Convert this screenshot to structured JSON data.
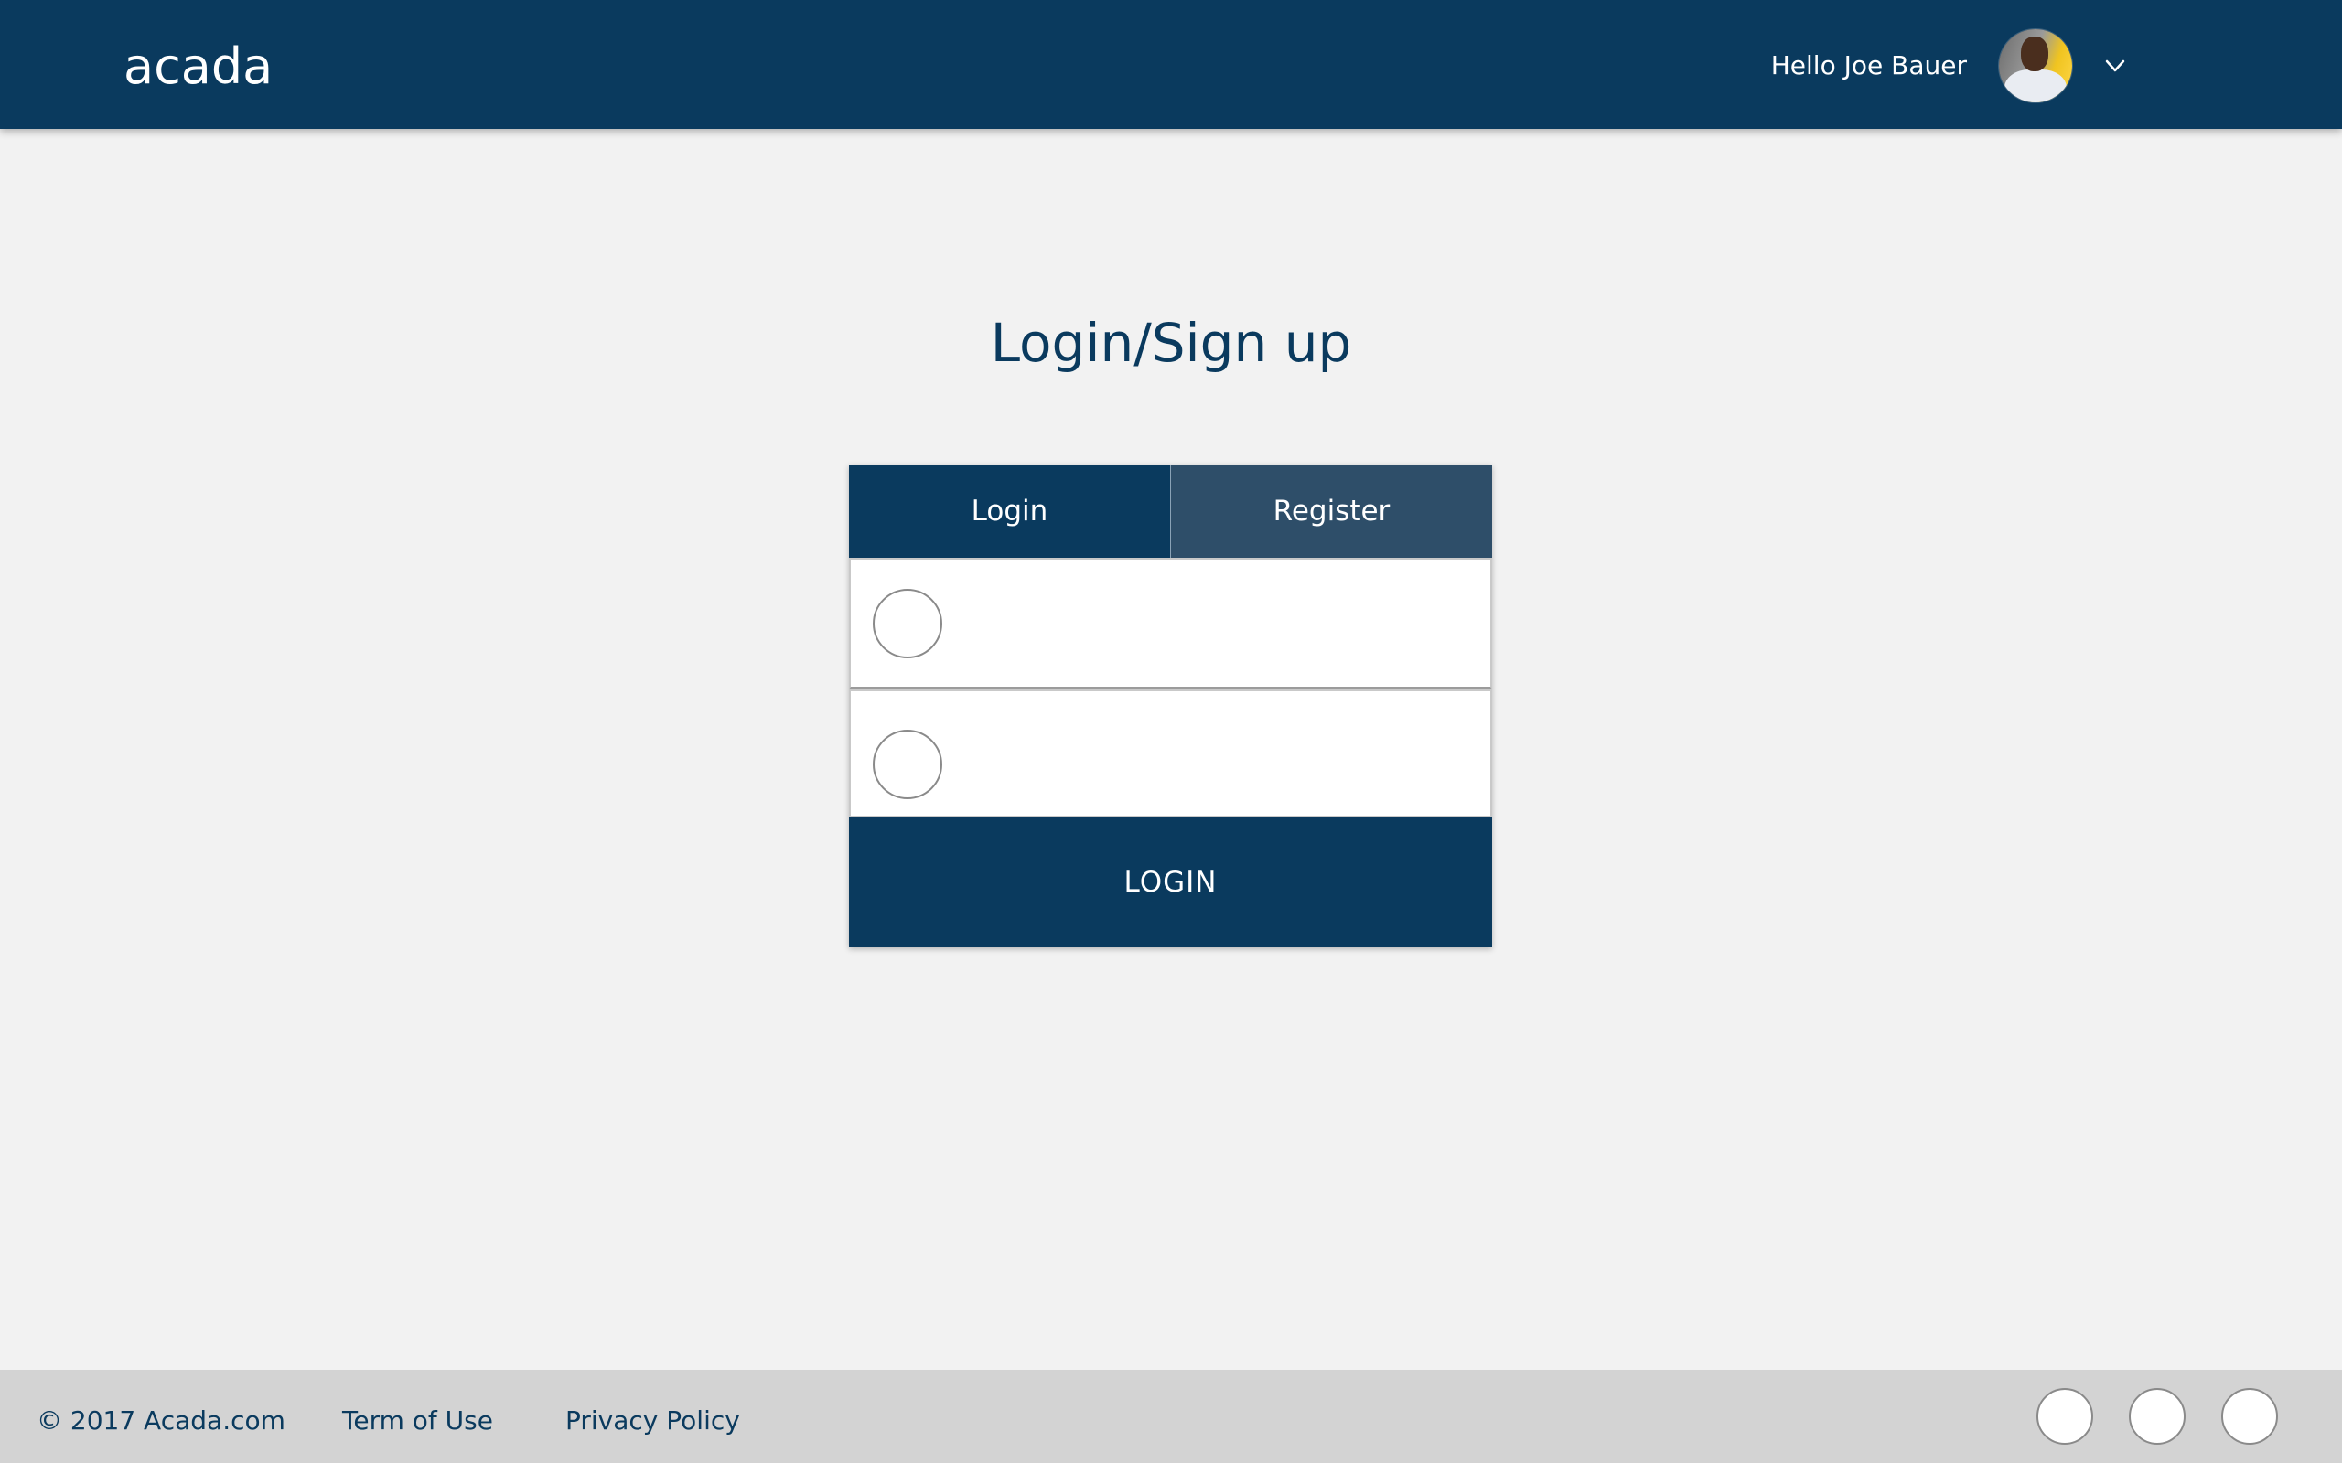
{
  "header": {
    "brand": "acada",
    "greeting": "Hello Joe Bauer",
    "avatar_alt": "user-avatar",
    "menu_icon": "chevron-down-icon"
  },
  "main": {
    "title": "Login/Sign up",
    "tabs": [
      {
        "label": "Login",
        "active": true
      },
      {
        "label": "Register",
        "active": false
      }
    ],
    "fields": [
      {
        "name": "username",
        "value": "",
        "placeholder": "",
        "icon": "user-icon"
      },
      {
        "name": "password",
        "value": "",
        "placeholder": "",
        "icon": "lock-icon"
      }
    ],
    "submit_label": "LOGIN"
  },
  "footer": {
    "copyright": "© 2017 Acada.com",
    "links": [
      "Term of Use",
      "Privacy Policy"
    ],
    "social_icons": [
      "social-icon-1",
      "social-icon-2",
      "social-icon-3"
    ]
  },
  "colors": {
    "primary": "#0a3a5e",
    "tab_inactive": "#2e4e69",
    "background": "#f2f2f2",
    "footer": "#d3d3d3"
  }
}
